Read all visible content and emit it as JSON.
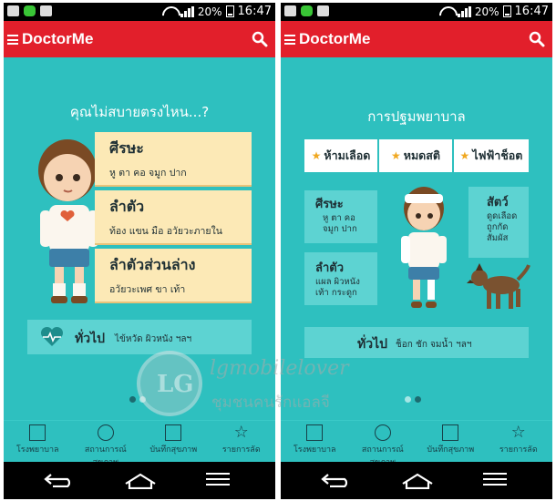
{
  "status": {
    "battery": "20%",
    "time": "16:47"
  },
  "app": {
    "title": "DoctorMe"
  },
  "left": {
    "heading": "คุณไม่สบายตรงไหน...?",
    "parts": [
      {
        "title": "ศีรษะ",
        "sub": "หู ตา คอ จมูก ปาก"
      },
      {
        "title": "ลำตัว",
        "sub": "ท้อง แขน มือ อวัยวะภายใน"
      },
      {
        "title": "ลำตัวส่วนล่าง",
        "sub": "อวัยวะเพศ ขา เท้า"
      }
    ],
    "general": {
      "title": "ทั่วไป",
      "sub": "ไข้หวัด ผิวหนัง ฯลฯ"
    }
  },
  "right": {
    "heading": "การปฐมพยาบาล",
    "tabs": [
      "ห้ามเลือด",
      "หมดสติ",
      "ไฟฟ้าช็อต"
    ],
    "head_card": {
      "title": "ศีรษะ",
      "sub1": "หู ตา คอ",
      "sub2": "จมูก ปาก"
    },
    "body_card": {
      "title": "ลำตัว",
      "sub1": "แผล ผิวหนัง",
      "sub2": "เท้า กระดูก"
    },
    "animal_card": {
      "title": "สัตว์",
      "sub1": "ดูดเลือด",
      "sub2": "ถูกกัด",
      "sub3": "สัมผัส"
    },
    "general": {
      "title": "ทั่วไป",
      "sub": "ช็อก ชัก จมน้ำ ฯลฯ"
    }
  },
  "nav": [
    {
      "label1": "โรงพยาบาล",
      "label2": ""
    },
    {
      "label1": "สถานการณ์",
      "label2": "สุขภาพ"
    },
    {
      "label1": "บันทึกสุขภาพ",
      "label2": ""
    },
    {
      "label1": "รายการลัด",
      "label2": ""
    }
  ],
  "watermark": {
    "text": "lgmobilelover",
    "sub": "ชุมชนคนรักแอลจี",
    "logo": "LG"
  },
  "colors": {
    "appbar": "#e21f2b",
    "background": "#2ec0bf",
    "card": "#fce9b6",
    "accent_card": "#5dd3d2"
  }
}
